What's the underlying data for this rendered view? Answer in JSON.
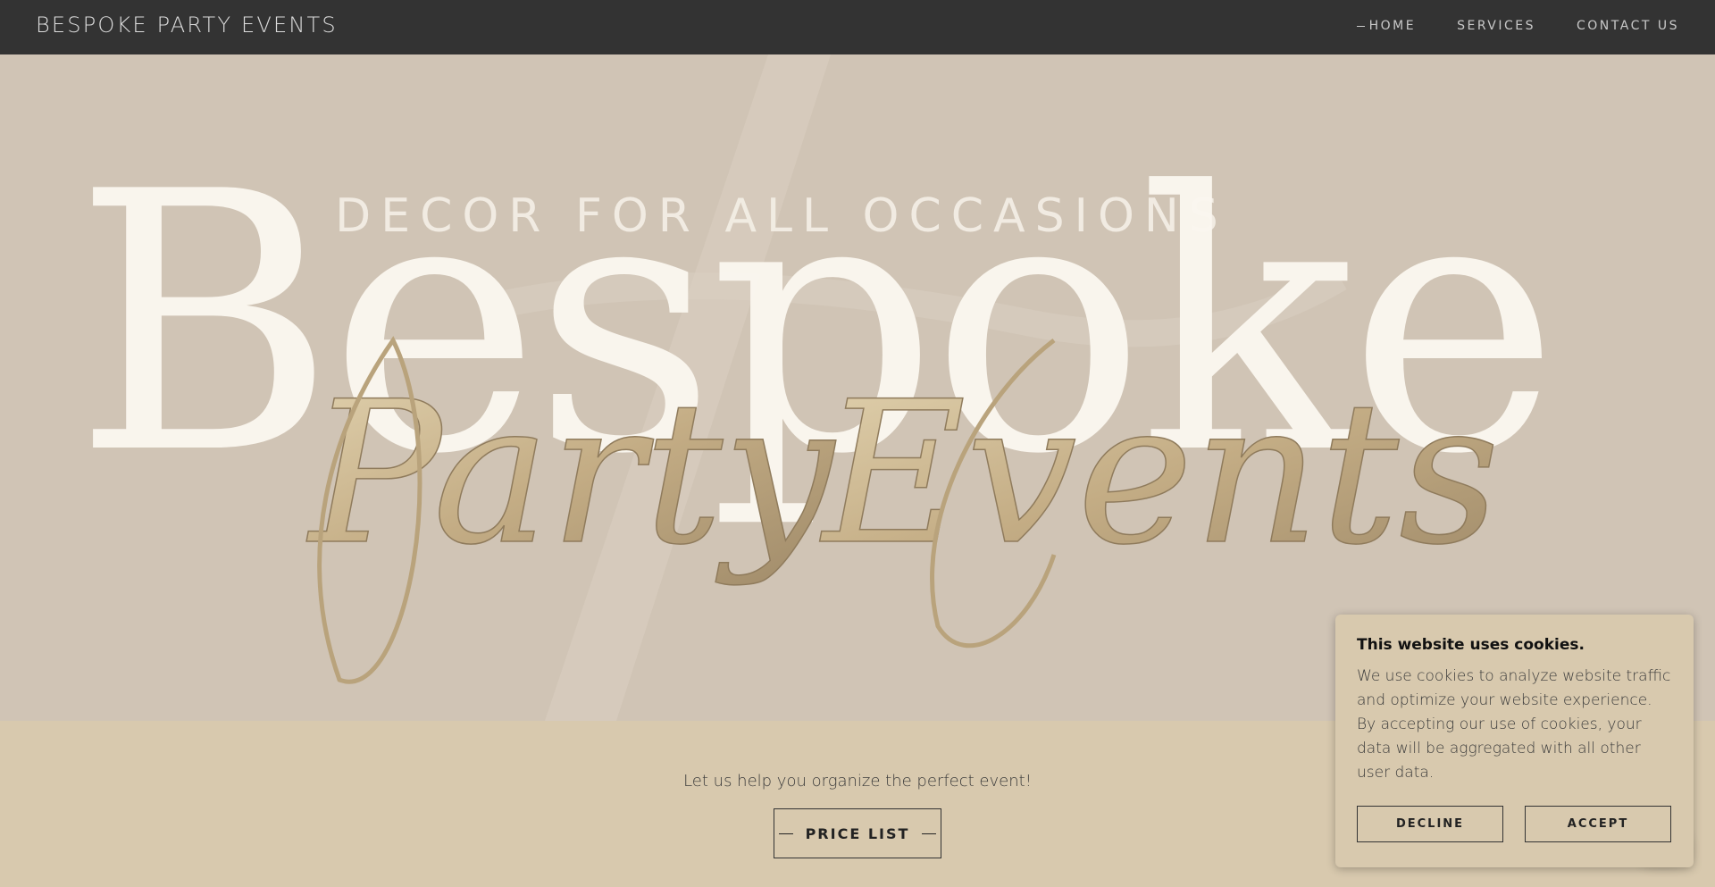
{
  "header": {
    "brand": "BESPOKE PARTY EVENTS",
    "nav": [
      {
        "label": "HOME",
        "active": true
      },
      {
        "label": "SERVICES",
        "active": false
      },
      {
        "label": "CONTACT US",
        "active": false
      }
    ]
  },
  "hero": {
    "logo_tagline": "DECOR FOR ALL OCCASIONS",
    "logo_word": "Bespoke",
    "logo_script_1": "Party",
    "logo_script_2": "Events",
    "colors": {
      "background": "#d0c4b5",
      "white": "#fbf7f0",
      "gold": "#c9b48d"
    }
  },
  "main": {
    "tagline": "Let us help you organize the perfect event!",
    "price_list_label": "PRICE LIST"
  },
  "cookie_banner": {
    "title": "This website uses cookies.",
    "message": "We use cookies to analyze website traffic and optimize your website experience. By accepting our use of cookies, your data will be aggregated with all other user data.",
    "decline_label": "DECLINE",
    "accept_label": "ACCEPT"
  },
  "colors": {
    "header_bg": "#333333",
    "page_bg": "#d8c9ae"
  }
}
